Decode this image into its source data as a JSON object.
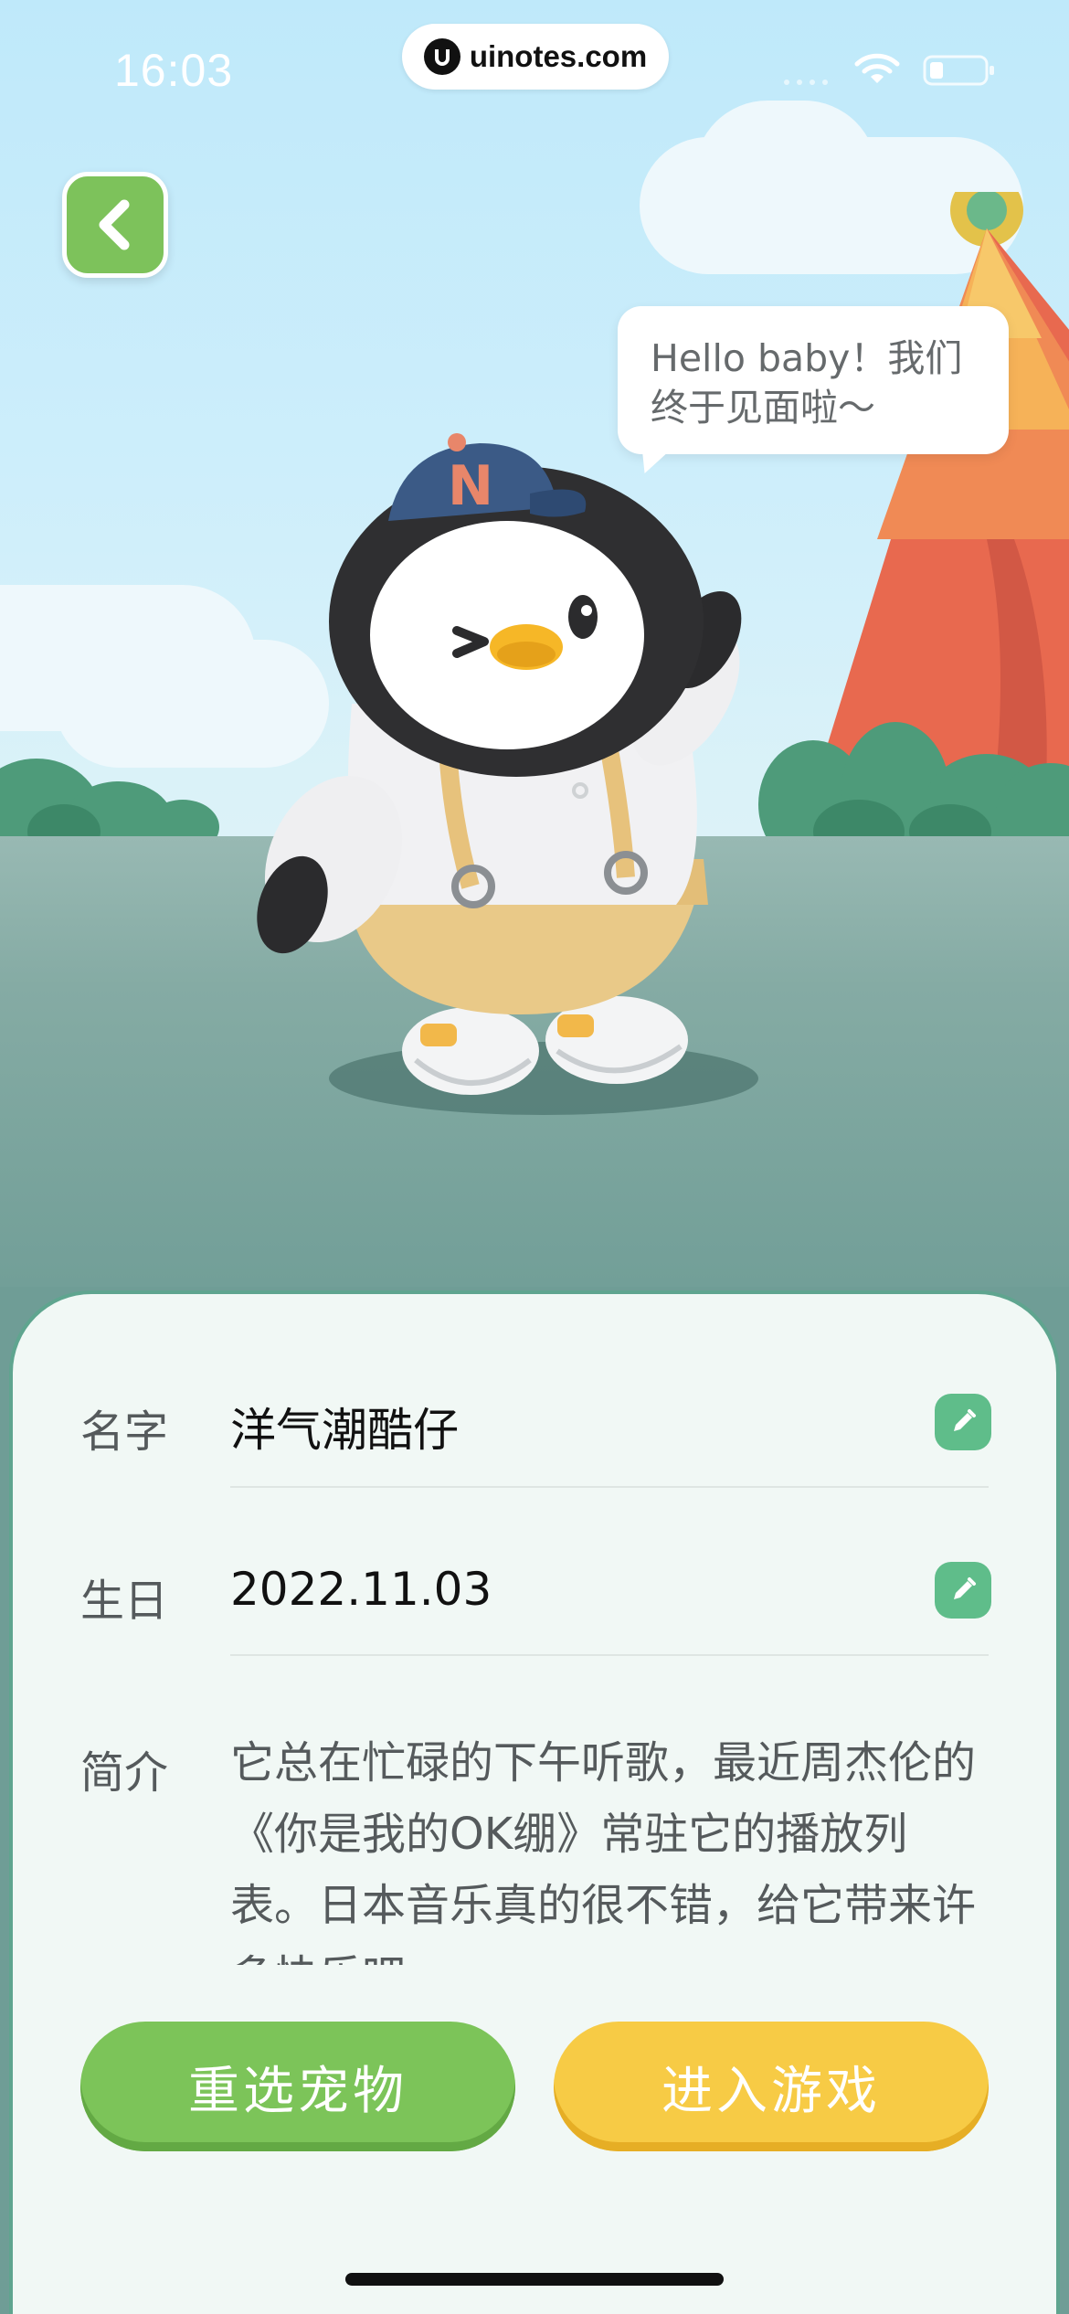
{
  "status_bar": {
    "time": "16:03",
    "url": "uinotes.com",
    "icons": [
      "signal-icon",
      "wifi-icon",
      "battery-icon"
    ]
  },
  "back_button": {
    "icon": "chevron-left-icon"
  },
  "speech_bubble": {
    "text": "Hello baby！我们\n终于见面啦～"
  },
  "pet": {
    "image": "penguin-mascot"
  },
  "profile": {
    "name": {
      "label": "名字",
      "value": "洋气潮酷仔",
      "edit_icon": "pencil-icon"
    },
    "birthday": {
      "label": "生日",
      "value": "2022.11.03",
      "edit_icon": "pencil-icon"
    },
    "intro": {
      "label": "简介",
      "value": "它总在忙碌的下午听歌，最近周杰伦的《你是我的OK绷》常驻它的播放列表。日本音乐真的很不错，给它带来许多快乐吧。"
    }
  },
  "actions": {
    "reselect_label": "重选宠物",
    "enter_label": "进入游戏"
  },
  "colors": {
    "green_button": "#7cc459",
    "yellow_button": "#f7cb45",
    "edit_icon_bg": "#5fbd8a",
    "card_bg": "#f1f8f5",
    "card_border": "#5fa58f"
  }
}
